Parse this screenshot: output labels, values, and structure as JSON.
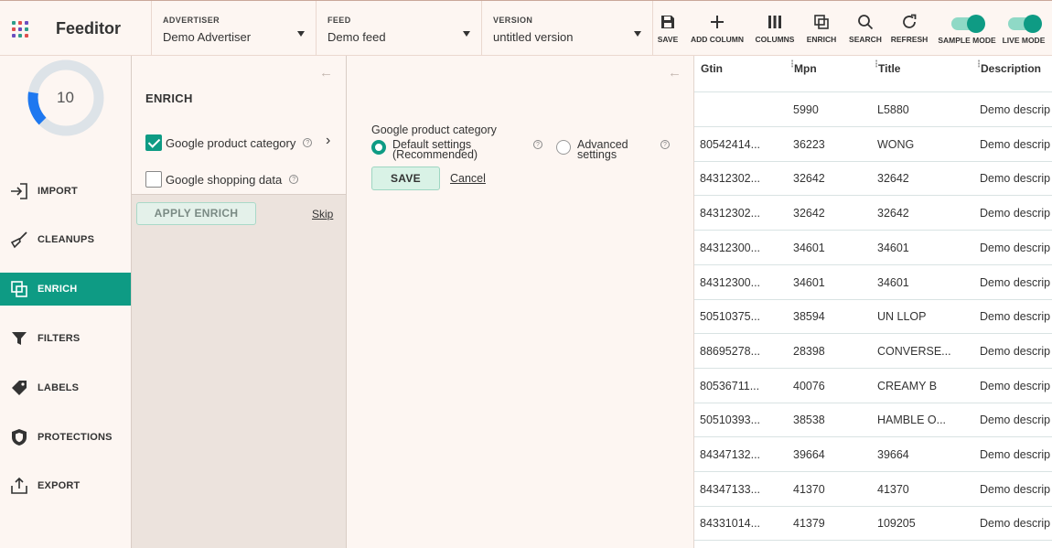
{
  "app": {
    "brand": "Feeditor"
  },
  "colors": {
    "accent": "#0e9b84",
    "logo": [
      "#2f9d8a",
      "#e0504f",
      "#6a4fbf",
      "#e0504f",
      "#6a4fbf",
      "#2f9d8a",
      "#6a4fbf",
      "#2f9d8a",
      "#e0504f"
    ]
  },
  "header": {
    "advertiser": {
      "label": "ADVERTISER",
      "value": "Demo Advertiser"
    },
    "feed": {
      "label": "FEED",
      "value": "Demo feed"
    },
    "version": {
      "label": "VERSION",
      "value": "untitled version"
    },
    "tools": {
      "save": "SAVE",
      "add_column": "ADD COLUMN",
      "columns": "COLUMNS",
      "enrich": "ENRICH",
      "search": "SEARCH",
      "refresh": "REFRESH",
      "sample_mode": "SAMPLE MODE",
      "live_mode": "LIVE MODE"
    }
  },
  "score": {
    "value": "10",
    "fraction": 0.15
  },
  "nav": {
    "import": "IMPORT",
    "cleanups": "CLEANUPS",
    "enrich": "ENRICH",
    "filters": "FILTERS",
    "labels": "LABELS",
    "protections": "PROTECTIONS",
    "export": "EXPORT"
  },
  "enrich_panel": {
    "title": "ENRICH",
    "options": {
      "gpc": "Google product category",
      "gsd": "Google shopping data"
    },
    "help": "?",
    "apply": "APPLY ENRICH",
    "skip": "Skip"
  },
  "settings": {
    "title": "Google product category",
    "default_line1": "Default settings",
    "default_line2": "(Recommended)",
    "advanced_line1": "Advanced",
    "advanced_line2": "settings",
    "save": "SAVE",
    "cancel": "Cancel"
  },
  "table": {
    "headers": [
      "Gtin",
      "Mpn",
      "Title",
      "Description"
    ],
    "rows": [
      [
        "",
        "5990",
        "L5880",
        "Demo descrip"
      ],
      [
        "80542414...",
        "36223",
        "WONG",
        "Demo descrip"
      ],
      [
        "84312302...",
        "32642",
        "32642",
        "Demo descrip"
      ],
      [
        "84312302...",
        "32642",
        "32642",
        "Demo descrip"
      ],
      [
        "84312300...",
        "34601",
        "34601",
        "Demo descrip"
      ],
      [
        "84312300...",
        "34601",
        "34601",
        "Demo descrip"
      ],
      [
        "50510375...",
        "38594",
        "UN LLOP",
        "Demo descrip"
      ],
      [
        "88695278...",
        "28398",
        "CONVERSE...",
        "Demo descrip"
      ],
      [
        "80536711...",
        "40076",
        "CREAMY B",
        "Demo descrip"
      ],
      [
        "50510393...",
        "38538",
        "HAMBLE O...",
        "Demo descrip"
      ],
      [
        "84347132...",
        "39664",
        "39664",
        "Demo descrip"
      ],
      [
        "84347133...",
        "41370",
        "41370",
        "Demo descrip"
      ],
      [
        "84331014...",
        "41379",
        "109205",
        "Demo descrip"
      ]
    ]
  }
}
